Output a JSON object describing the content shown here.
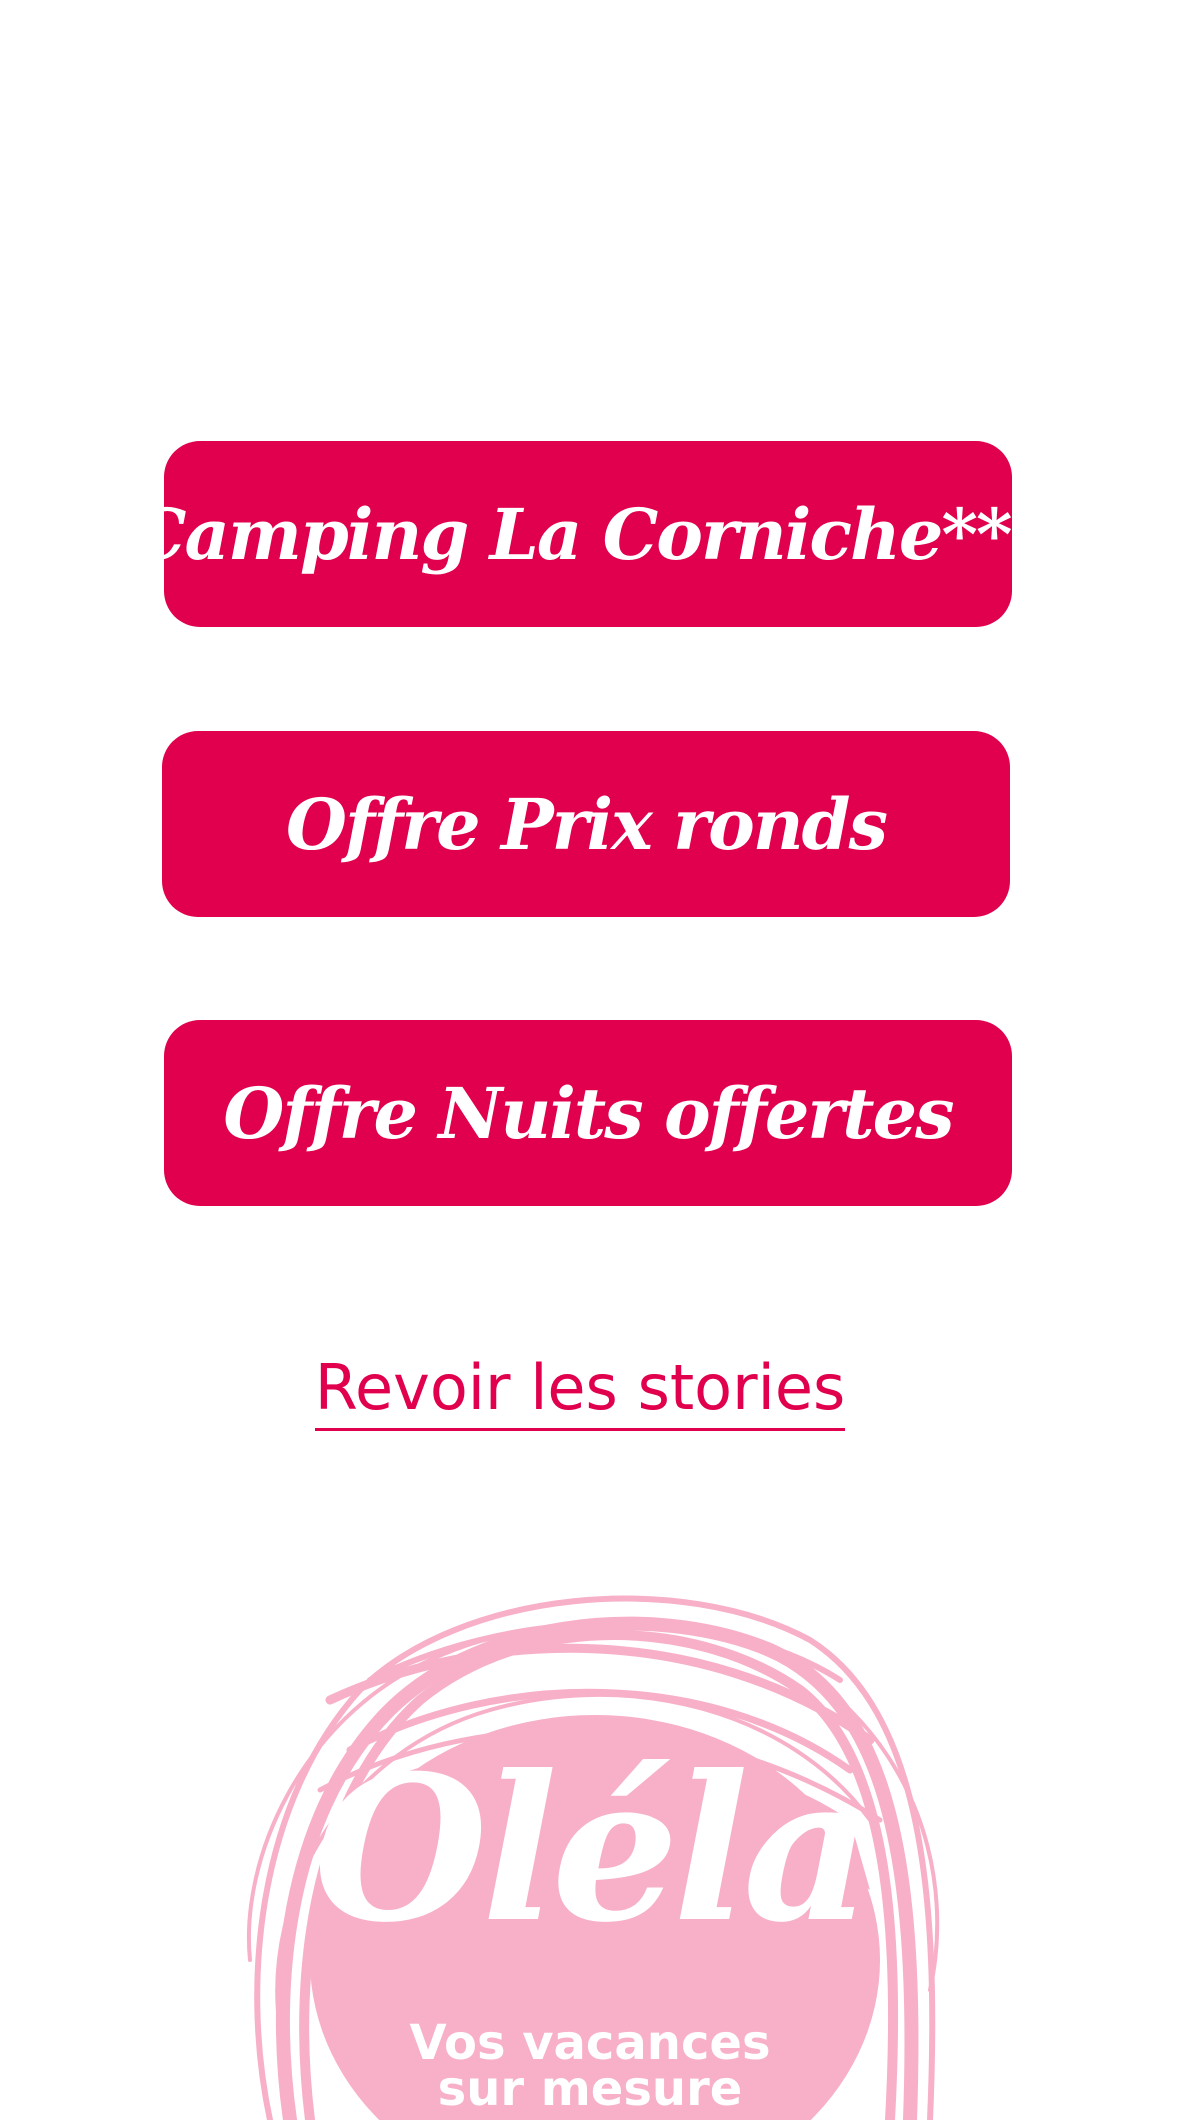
{
  "offers": [
    {
      "label": "Camping La Corniche***"
    },
    {
      "label": "Offre Prix ronds"
    },
    {
      "label": "Offre Nuits offertes"
    }
  ],
  "revoir_link": {
    "label": "Revoir les stories"
  },
  "logo": {
    "brand": "Oléla",
    "tagline_line1": "Vos vacances",
    "tagline_line2": "sur mesure"
  },
  "colors": {
    "accent": "#e0004d",
    "logo_pink": "#f7b0c7",
    "background": "#ffffff"
  }
}
